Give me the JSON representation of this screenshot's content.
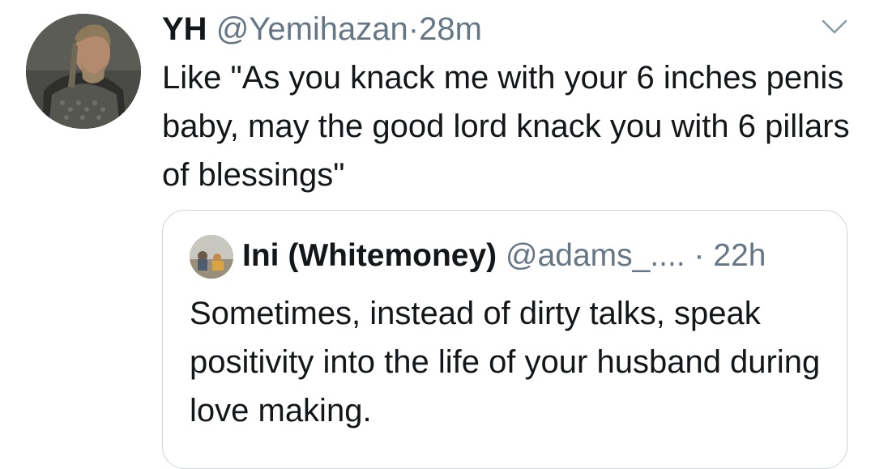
{
  "tweet": {
    "display_name": "YH",
    "handle": "@Yemihazan",
    "separator": "·",
    "time": "28m",
    "text": "Like \"As you knack me with your 6 inches penis baby, may the good lord knack you with 6 pillars of blessings\"",
    "menu_icon": "chevron-down-icon"
  },
  "quoted_tweet": {
    "display_name": "Ini (Whitemoney)",
    "handle": "@adams_....",
    "separator": "·",
    "time": "22h",
    "text": "Sometimes, instead of dirty talks, speak positivity into the life of your husband during love making."
  },
  "colors": {
    "primary_text": "#14171a",
    "secondary_text": "#657786",
    "border": "#ccd6dd"
  }
}
